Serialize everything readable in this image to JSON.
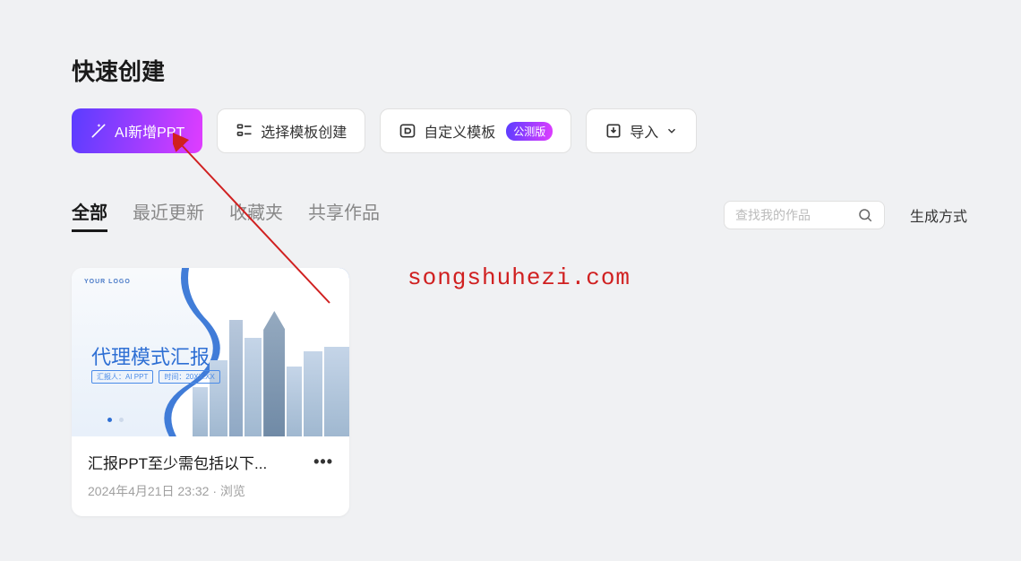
{
  "header": {
    "title": "快速创建"
  },
  "buttons": {
    "ai_create_label": "AI新增PPT",
    "template_create_label": "选择模板创建",
    "custom_template_label": "自定义模板",
    "custom_template_badge": "公测版",
    "import_label": "导入"
  },
  "tabs": {
    "all": "全部",
    "recent": "最近更新",
    "favorites": "收藏夹",
    "shared": "共享作品"
  },
  "search": {
    "placeholder": "查找我的作品"
  },
  "side_link": {
    "generate_label": "生成方式"
  },
  "card": {
    "thumb_logo": "YOUR LOGO",
    "thumb_title": "代理模式汇报",
    "thumb_meta1": "汇报人：AI PPT",
    "thumb_meta2": "时间：20XX.XX",
    "title": "汇报PPT至少需包括以下...",
    "timestamp": "2024年4月21日 23:32 · 浏览"
  },
  "watermark": "songshuhezi.com"
}
